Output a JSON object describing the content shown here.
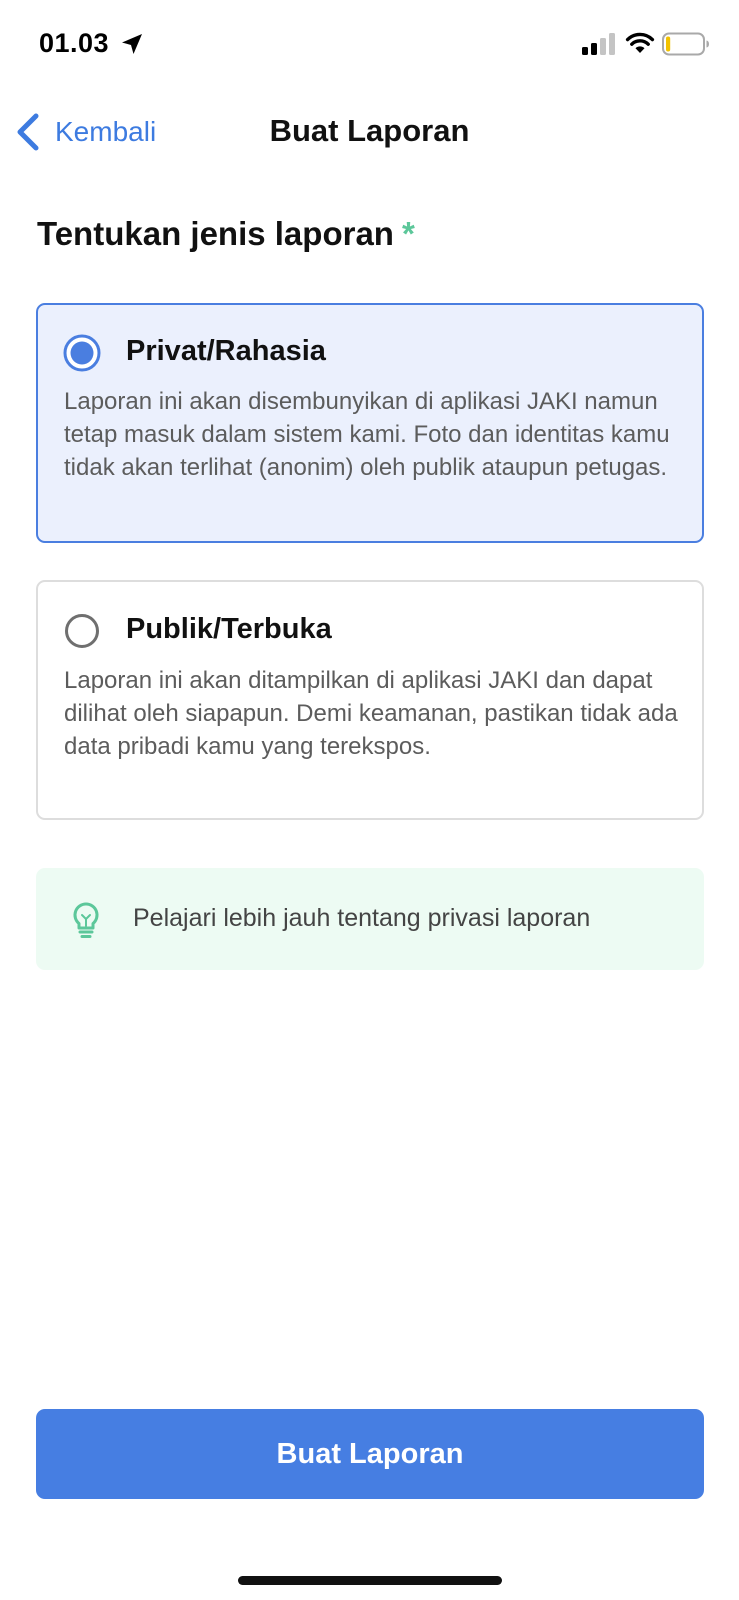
{
  "status_bar": {
    "time": "01.03",
    "icons": [
      "location-arrow-icon",
      "cellular-signal-icon",
      "wifi-icon",
      "battery-low-icon"
    ],
    "battery_level": 0.12
  },
  "nav": {
    "back_label": "Kembali",
    "title": "Buat Laporan"
  },
  "section": {
    "title": "Tentukan jenis laporan",
    "required_mark": "*"
  },
  "options": [
    {
      "title": "Privat/Rahasia",
      "description": "Laporan ini akan disembunyikan di aplikasi JAKI namun tetap masuk dalam sistem kami. Foto dan identitas kamu tidak akan terlihat (anonim) oleh publik ataupun petugas.",
      "selected": true
    },
    {
      "title": "Publik/Terbuka",
      "description": "Laporan ini akan ditampilkan di aplikasi JAKI dan dapat dilihat oleh siapapun. Demi keamanan, pastikan tidak ada data pribadi kamu yang terekspos.",
      "selected": false
    }
  ],
  "info_banner": {
    "icon": "lightbulb-icon",
    "text": "Pelajari lebih jauh tentang privasi laporan"
  },
  "primary_button": {
    "label": "Buat Laporan"
  },
  "colors": {
    "accent": "#467ee2",
    "link": "#3d7be0",
    "selected_card_bg": "#ebf0fd",
    "selected_card_border": "#4a7ee0",
    "required": "#5cc79a",
    "info_bg": "#edfbf3",
    "info_icon": "#5cc79a",
    "battery_low": "#f2c200"
  }
}
